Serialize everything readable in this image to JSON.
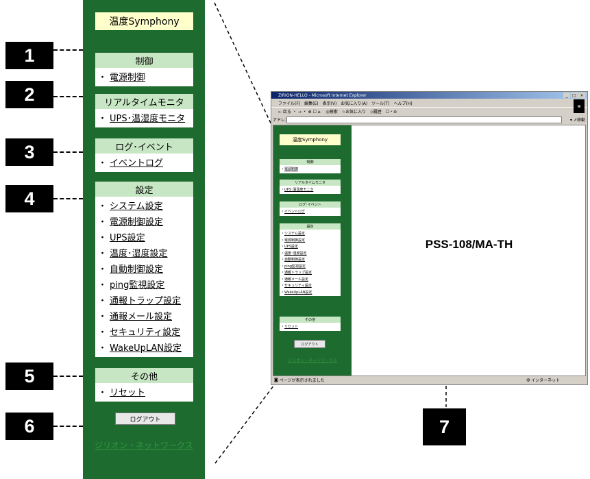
{
  "sidebar": {
    "brand": "温度Symphony",
    "sections": [
      {
        "title": "制御",
        "items": [
          "電源制御"
        ]
      },
      {
        "title": "リアルタイムモニタ",
        "items": [
          "UPS･温湿度モニタ"
        ]
      },
      {
        "title": "ログ･イベント",
        "items": [
          "イベントログ"
        ]
      },
      {
        "title": "設定",
        "items": [
          "システム設定",
          "電源制御設定",
          "UPS設定",
          "温度･湿度設定",
          "自動制御設定",
          "ping監視設定",
          "通報トラップ設定",
          "通報メール設定",
          "セキュリティ設定",
          "WakeUpLAN設定"
        ]
      },
      {
        "title": "その他",
        "items": [
          "リセット"
        ]
      }
    ],
    "bullet": "・",
    "logout_label": "ログアウト",
    "footer_link": "ジリオン・ネットワークス"
  },
  "callouts": [
    "1",
    "2",
    "3",
    "4",
    "5",
    "6",
    "7"
  ],
  "browser": {
    "title": "ZIRION-HELLO - Microsoft Internet Explorer",
    "window_buttons": [
      "_",
      "□",
      "×"
    ],
    "menu": "ファイル(F)　編集(E)　表示(V)　お気に入り(A)　ツール(T)　ヘルプ(H)",
    "toolbar": "← 戻る ・ → ・ ⊗ ☐ ⌂ 　◎検索　☆お気に入り　◇履歴　☐・⊜",
    "address_label": "アドレス(D)",
    "go_label": "▾ ⇗移動",
    "links_label": "リンク »",
    "model": "PSS-108/MA-TH",
    "status_text": "ページが表示されました",
    "status_zone": "インターネット"
  },
  "colors": {
    "sidebar_green": "#1e6b30",
    "section_header": "#c7e6c3",
    "brand_bg": "#ffffcc",
    "footer_link": "#2f9a3f"
  }
}
